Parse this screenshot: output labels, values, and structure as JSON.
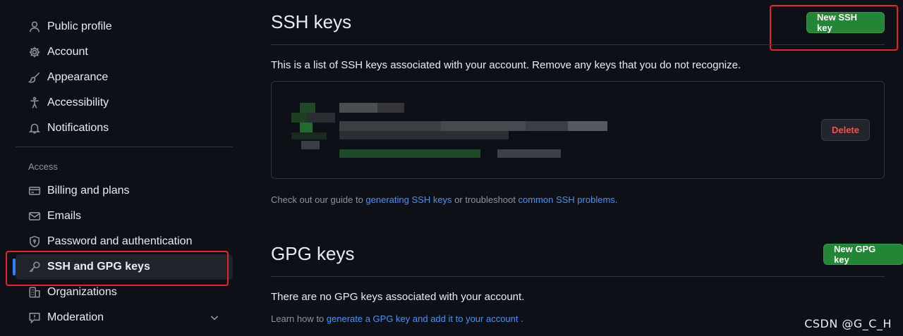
{
  "sidebar": {
    "items_top": [
      {
        "label": "Public profile",
        "icon": "person-icon"
      },
      {
        "label": "Account",
        "icon": "gear-icon"
      },
      {
        "label": "Appearance",
        "icon": "paintbrush-icon"
      },
      {
        "label": "Accessibility",
        "icon": "accessibility-icon"
      },
      {
        "label": "Notifications",
        "icon": "bell-icon"
      }
    ],
    "access_heading": "Access",
    "items_access": [
      {
        "label": "Billing and plans",
        "icon": "credit-card-icon"
      },
      {
        "label": "Emails",
        "icon": "mail-icon"
      },
      {
        "label": "Password and authentication",
        "icon": "shield-lock-icon"
      },
      {
        "label": "SSH and GPG keys",
        "icon": "key-icon",
        "active": true
      },
      {
        "label": "Organizations",
        "icon": "organization-icon"
      },
      {
        "label": "Moderation",
        "icon": "report-icon"
      }
    ]
  },
  "ssh": {
    "title": "SSH keys",
    "new_button": "New SSH key",
    "description": "This is a list of SSH keys associated with your account. Remove any keys that you do not recognize.",
    "delete_button": "Delete",
    "hint_prefix": "Check out our guide to ",
    "hint_link1": "generating SSH keys",
    "hint_middle": " or troubleshoot ",
    "hint_link2": "common SSH problems",
    "hint_suffix": "."
  },
  "gpg": {
    "title": "GPG keys",
    "new_button": "New GPG key",
    "empty_text": "There are no GPG keys associated with your account.",
    "learn_prefix": "Learn how to ",
    "learn_link": "generate a GPG key and add it to your account",
    "learn_suffix": " ."
  },
  "watermark": "CSDN @G_C_H",
  "colors": {
    "background": "#0d1117",
    "accent_green": "#238636",
    "link": "#4493f8",
    "danger": "#f85149",
    "highlight": "#e5252a",
    "active_indicator": "#2f81f7"
  }
}
